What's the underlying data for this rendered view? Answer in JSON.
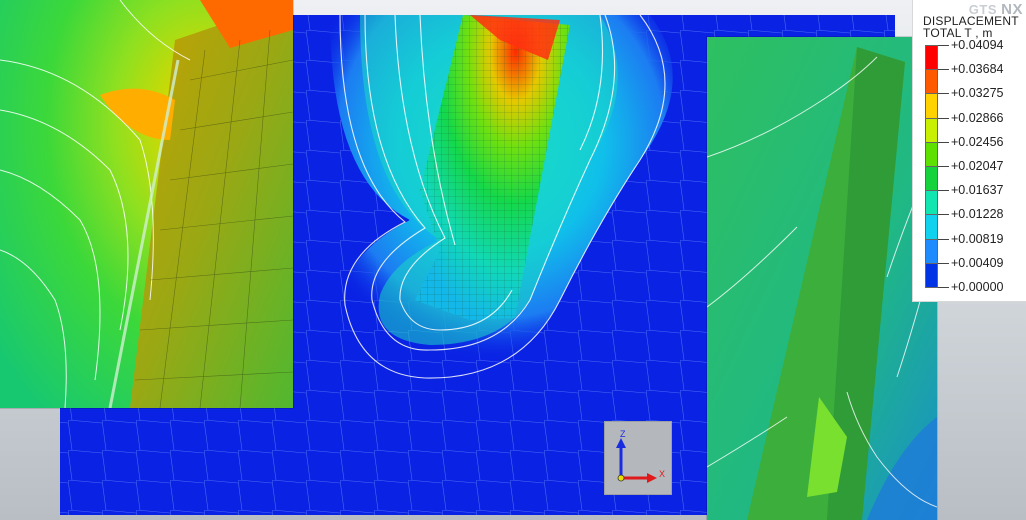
{
  "legend": {
    "title": "DISPLACEMENT",
    "subtitle": "TOTAL T , m",
    "logo_small": "GTS",
    "logo_large": "NX",
    "colors": [
      "#ff0000",
      "#ff5a00",
      "#ffd200",
      "#c8f000",
      "#5ee000",
      "#16d23c",
      "#12e6b0",
      "#10d2ef",
      "#1e8cff",
      "#0032e6"
    ],
    "values": [
      "+0.04094",
      "+0.03684",
      "+0.03275",
      "+0.02866",
      "+0.02456",
      "+0.02047",
      "+0.01637",
      "+0.01228",
      "+0.00819",
      "+0.00409",
      "+0.00000"
    ]
  },
  "axis_widget": {
    "z_label": "Z",
    "x_label": "X",
    "z_color": "#1a2ce0",
    "x_color": "#e01a1a"
  }
}
